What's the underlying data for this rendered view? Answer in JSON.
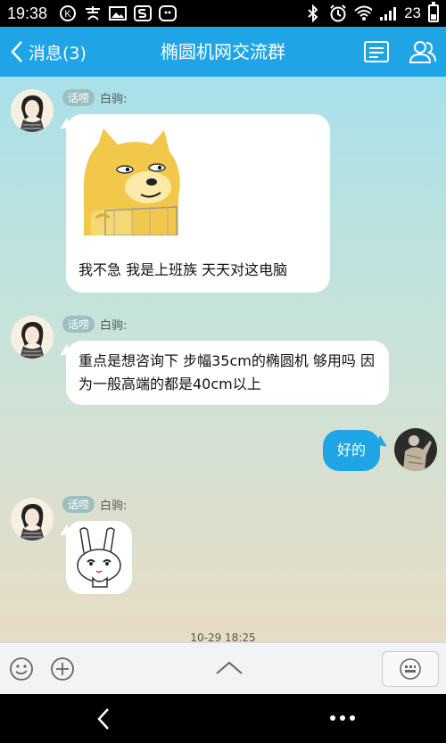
{
  "status_bar": {
    "time": "19:38",
    "signal_number": "23",
    "icons_left": [
      "k-icon",
      "alipay-icon",
      "image-icon",
      "s-icon",
      "qq-icon"
    ],
    "icons_right": [
      "bluetooth-icon",
      "alarm-icon",
      "wifi-icon",
      "signal-icon",
      "battery-icon"
    ]
  },
  "header": {
    "back_label": "消息(3)",
    "title": "椭圆机网交流群",
    "accent_color": "#1fa5e6"
  },
  "messages": [
    {
      "sender_tag": "话唠",
      "sender_name": "白驹:",
      "text": "我不急 我是上班族 天天对这电脑",
      "has_image": true,
      "image": "doge-sticker"
    },
    {
      "sender_tag": "话唠",
      "sender_name": "白驹:",
      "text": "重点是想咨询下 步幅35cm的椭圆机 够用吗  因为一般高端的都是40cm以上"
    },
    {
      "self": true,
      "text": "好的"
    },
    {
      "sender_tag": "话唠",
      "sender_name": "白驹:",
      "image": "rabbit-sticker"
    }
  ],
  "timestamp": "10-29 18:25",
  "input_bar": {
    "icons": [
      "emoji-icon",
      "plus-icon",
      "chevron-up-icon",
      "keyboard-icon"
    ]
  },
  "nav_bar": {
    "icons": [
      "back-icon",
      "more-icon"
    ]
  }
}
